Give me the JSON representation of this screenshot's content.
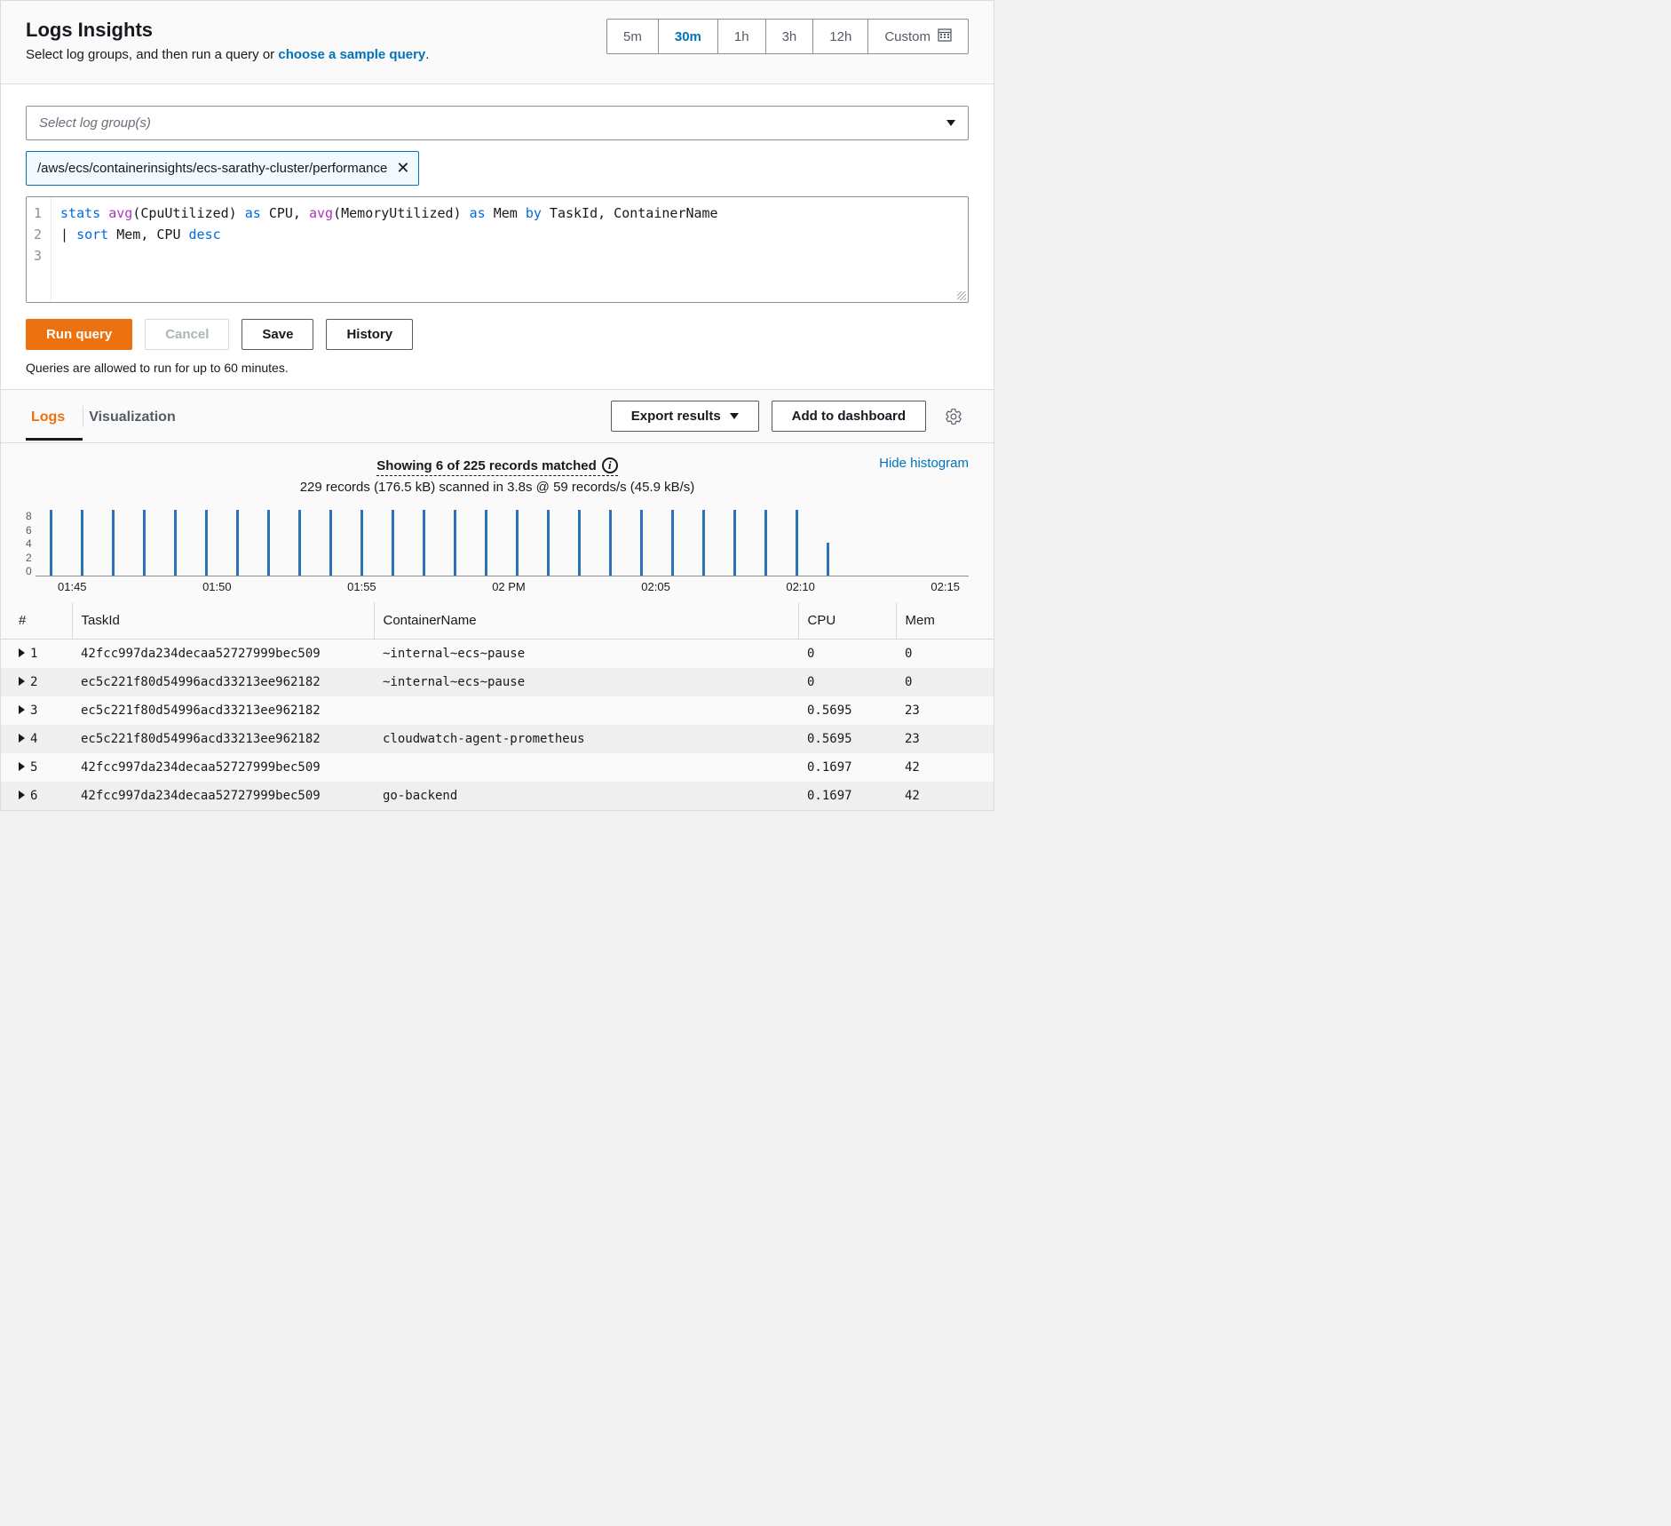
{
  "header": {
    "title": "Logs Insights",
    "subtitle_prefix": "Select log groups, and then run a query or ",
    "subtitle_link": "choose a sample query",
    "subtitle_suffix": "."
  },
  "time_range": {
    "options": [
      "5m",
      "30m",
      "1h",
      "3h",
      "12h"
    ],
    "active": "30m",
    "custom_label": "Custom"
  },
  "log_group_select_placeholder": "Select log group(s)",
  "selected_log_group": "/aws/ecs/containerinsights/ecs-sarathy-cluster/performance",
  "query_lines": {
    "l1": {
      "cmd": "stats",
      "f1": "avg",
      "arg1": "(CpuUtilized)",
      "as1": "as",
      "al1": " CPU, ",
      "f2": "avg",
      "arg2": "(MemoryUtilized)",
      "as2": "as",
      "al2": " Mem ",
      "by": "by",
      "rest": " TaskId, ContainerName"
    },
    "l2": {
      "pipe": "| ",
      "cmd": "sort",
      "rest": " Mem, CPU ",
      "desc": "desc"
    }
  },
  "buttons": {
    "run": "Run query",
    "cancel": "Cancel",
    "save": "Save",
    "history": "History"
  },
  "hint": "Queries are allowed to run for up to 60 minutes.",
  "tabs": {
    "logs": "Logs",
    "viz": "Visualization"
  },
  "actions": {
    "export": "Export results",
    "add_dash": "Add to dashboard"
  },
  "summary": {
    "line1": "Showing 6 of 225 records matched",
    "line2": "229 records (176.5 kB) scanned in 3.8s @ 59 records/s (45.9 kB/s)",
    "hide": "Hide histogram"
  },
  "chart_data": {
    "type": "bar",
    "title": "",
    "xlabel": "",
    "ylabel": "",
    "ylim": [
      0,
      8
    ],
    "y_ticks": [
      "8",
      "6",
      "4",
      "2",
      "0"
    ],
    "x_ticks": [
      "01:45",
      "01:50",
      "01:55",
      "02 PM",
      "02:05",
      "02:10",
      "02:15"
    ],
    "values": [
      8,
      8,
      8,
      8,
      8,
      8,
      8,
      8,
      8,
      8,
      8,
      8,
      8,
      8,
      8,
      8,
      8,
      8,
      8,
      8,
      8,
      8,
      8,
      8,
      8,
      4
    ]
  },
  "table": {
    "columns": [
      "#",
      "TaskId",
      "ContainerName",
      "CPU",
      "Mem"
    ],
    "rows": [
      {
        "n": "1",
        "task": "42fcc997da234decaa52727999bec509",
        "container": "~internal~ecs~pause",
        "cpu": "0",
        "mem": "0"
      },
      {
        "n": "2",
        "task": "ec5c221f80d54996acd33213ee962182",
        "container": "~internal~ecs~pause",
        "cpu": "0",
        "mem": "0"
      },
      {
        "n": "3",
        "task": "ec5c221f80d54996acd33213ee962182",
        "container": "",
        "cpu": "0.5695",
        "mem": "23"
      },
      {
        "n": "4",
        "task": "ec5c221f80d54996acd33213ee962182",
        "container": "cloudwatch-agent-prometheus",
        "cpu": "0.5695",
        "mem": "23"
      },
      {
        "n": "5",
        "task": "42fcc997da234decaa52727999bec509",
        "container": "",
        "cpu": "0.1697",
        "mem": "42"
      },
      {
        "n": "6",
        "task": "42fcc997da234decaa52727999bec509",
        "container": "go-backend",
        "cpu": "0.1697",
        "mem": "42"
      }
    ]
  }
}
